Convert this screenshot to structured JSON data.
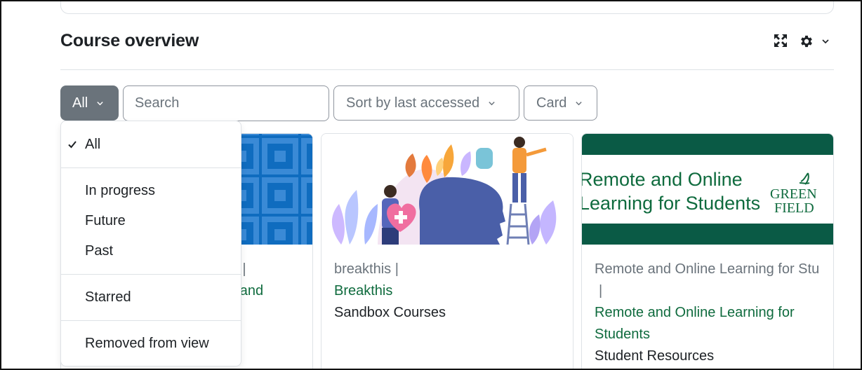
{
  "block": {
    "title": "Course overview"
  },
  "controls": {
    "grouping_label": "All",
    "search_placeholder": "Search",
    "sort_label": "Sort by last accessed",
    "view_label": "Card"
  },
  "dropdown": {
    "selected": "All",
    "items": [
      {
        "label": "All"
      },
      {
        "label": "In progress"
      },
      {
        "label": "Future"
      },
      {
        "label": "Past"
      },
      {
        "label": "Starred"
      },
      {
        "label": "Removed from view"
      }
    ]
  },
  "courses": [
    {
      "category": "T |",
      "name": "gn and",
      "sub": ""
    },
    {
      "category": "breakthis |",
      "name": "Breakthis",
      "sub": "Sandbox Courses"
    },
    {
      "category": "Remote and Online Learning for Stu",
      "category_sep": "|",
      "name_line1": "Remote and Online Learning for",
      "name_line2": "Students",
      "sub": "Student Resources",
      "image_text_line1": "Remote and Online",
      "image_text_line2": "Learning for Students",
      "logo_line1": "GREEN",
      "logo_line2": "FIELD"
    }
  ],
  "colors": {
    "accent_green": "#0f6b3e",
    "grouping_button": "#6a737b",
    "card1_image": "#0f6cbf",
    "card3_band": "#0a5a45"
  },
  "icons": {
    "expand": "expand-icon",
    "settings": "gear-icon",
    "dropdown": "chevron-down-icon",
    "check": "check-icon"
  }
}
